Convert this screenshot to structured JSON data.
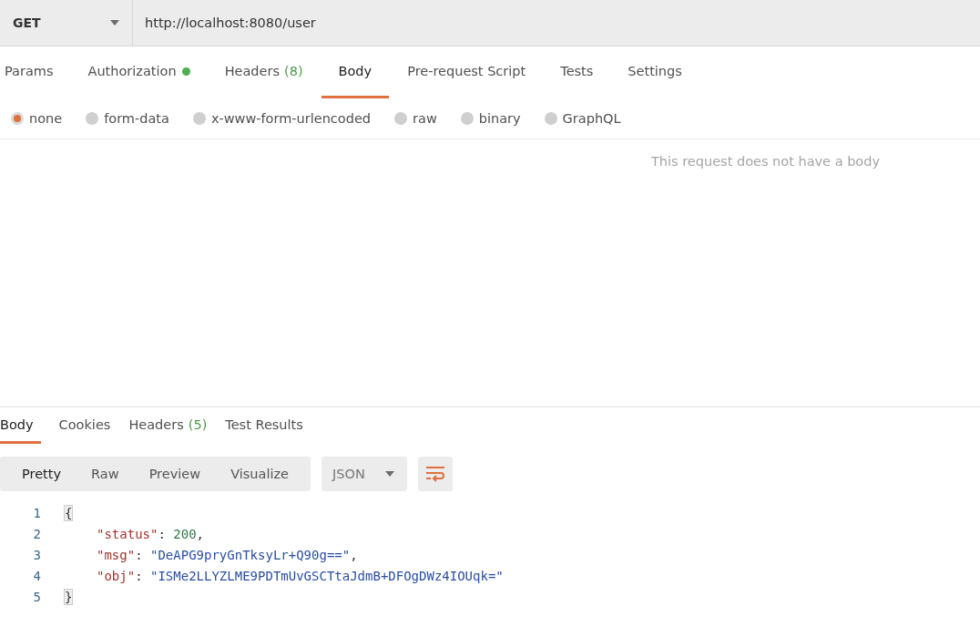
{
  "request": {
    "method": "GET",
    "url": "http://localhost:8080/user"
  },
  "request_tabs": [
    {
      "label": "Params",
      "selected": false
    },
    {
      "label": "Authorization",
      "selected": false,
      "color": "#4caf50"
    },
    {
      "label": "Headers",
      "count": "(8)",
      "selected": false
    },
    {
      "label": "Body",
      "selected": true
    },
    {
      "label": "Pre-request Script",
      "selected": false
    },
    {
      "label": "Tests",
      "selected": false
    },
    {
      "label": "Settings",
      "selected": false
    }
  ],
  "body_types": [
    {
      "label": "none",
      "selected": true
    },
    {
      "label": "form-data",
      "selected": false
    },
    {
      "label": "x-www-form-urlencoded",
      "selected": false
    },
    {
      "label": "raw",
      "selected": false
    },
    {
      "label": "binary",
      "selected": false
    },
    {
      "label": "GraphQL",
      "selected": false
    }
  ],
  "body_message": "This request does not have a body",
  "response_tabs": [
    {
      "label": "Body",
      "selected": true
    },
    {
      "label": "Cookies",
      "selected": false
    },
    {
      "label": "Headers",
      "count": "(5)",
      "selected": false
    },
    {
      "label": "Test Results",
      "selected": false
    }
  ],
  "view_modes": [
    {
      "label": "Pretty",
      "selected": true
    },
    {
      "label": "Raw",
      "selected": false
    },
    {
      "label": "Preview",
      "selected": false
    },
    {
      "label": "Visualize",
      "selected": false
    }
  ],
  "format": "JSON",
  "code_lines": [
    {
      "number": "1",
      "tokens": [
        {
          "kind": "brace",
          "text": "{"
        }
      ]
    },
    {
      "number": "2",
      "tokens": [
        {
          "kind": "key",
          "text": "\"status\""
        },
        {
          "kind": "punct",
          "text": ": "
        },
        {
          "kind": "number",
          "text": "200"
        },
        {
          "kind": "punct",
          "text": ","
        }
      ]
    },
    {
      "number": "3",
      "tokens": [
        {
          "kind": "key",
          "text": "\"msg\""
        },
        {
          "kind": "punct",
          "text": ": "
        },
        {
          "kind": "string",
          "text": "\"DeAPG9pryGnTksyLr+Q90g==\""
        },
        {
          "kind": "punct",
          "text": ","
        }
      ]
    },
    {
      "number": "4",
      "tokens": [
        {
          "kind": "key",
          "text": "\"obj\""
        },
        {
          "kind": "punct",
          "text": ": "
        },
        {
          "kind": "string",
          "text": "\"ISMe2LLYZLME9PDTmUvGSCTtaJdmB+DFOgDWz4IOUqk=\""
        }
      ]
    },
    {
      "number": "5",
      "tokens": [
        {
          "kind": "brace",
          "text": "}"
        }
      ]
    }
  ]
}
